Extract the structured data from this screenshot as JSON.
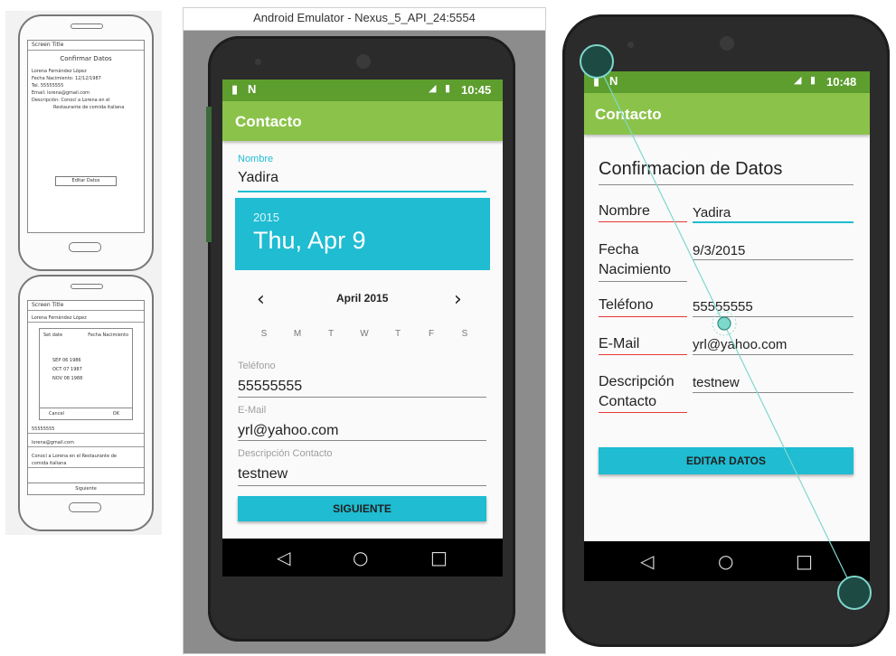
{
  "sketch": {
    "phone1": {
      "title": "Screen Title",
      "heading": "Confirmar Datos",
      "lines": [
        "Lorena Fernández López",
        "Fecha Nacimiento: 12/12/1987",
        "Tel. 55555555",
        "Email: lorena@gmail.com",
        "Descripción: Conocí a Lorena en el",
        "Restaurante de comida italiana"
      ],
      "button": "Editar Datos"
    },
    "phone2": {
      "title": "Screen Title",
      "name": "Lorena Fernández López",
      "picker_left": "Set date",
      "picker_right": "Fecha Nacimiento",
      "rows": [
        "SEP  06  1986",
        "OCT  07  1987",
        "NOV  08  1988"
      ],
      "cancel": "Cancel",
      "ok": "OK",
      "phone": "55555555",
      "email": "lorena@gmail.com",
      "desc": "Conocí a Lorena en el Restaurante de comida italiana",
      "button": "Siguiente"
    }
  },
  "emulator": {
    "window_title": "Android Emulator - Nexus_5_API_24:5554",
    "status_time": "10:45",
    "app_title": "Contacto",
    "nombre_label": "Nombre",
    "nombre_value": "Yadira",
    "dp_year": "2015",
    "dp_date": "Thu, Apr 9",
    "dp_month": "April 2015",
    "dp_prev": "‹",
    "dp_next": "›",
    "dp_weekdays": [
      "S",
      "M",
      "T",
      "W",
      "T",
      "F",
      "S"
    ],
    "telefono_label": "Teléfono",
    "telefono_value": "55555555",
    "email_label": "E-Mail",
    "email_value": "yrl@yahoo.com",
    "desc_label": "Descripción Contacto",
    "desc_value": "testnew",
    "button": "SIGUIENTE"
  },
  "device2": {
    "status_time": "10:48",
    "app_title": "Contacto",
    "heading": "Confirmacion de Datos",
    "rows": [
      {
        "label": "Nombre",
        "value": "Yadira"
      },
      {
        "label": "Fecha Nacimiento",
        "value": "9/3/2015"
      },
      {
        "label": "Teléfono",
        "value": "55555555"
      },
      {
        "label": "E-Mail",
        "value": "yrl@yahoo.com"
      },
      {
        "label": "Descripción Contacto",
        "value": "testnew"
      }
    ],
    "button": "EDITAR DATOS"
  },
  "colors": {
    "accent": "#1fbcd2",
    "appbar": "#8bc34a",
    "statusbar": "#5d9e2e"
  }
}
